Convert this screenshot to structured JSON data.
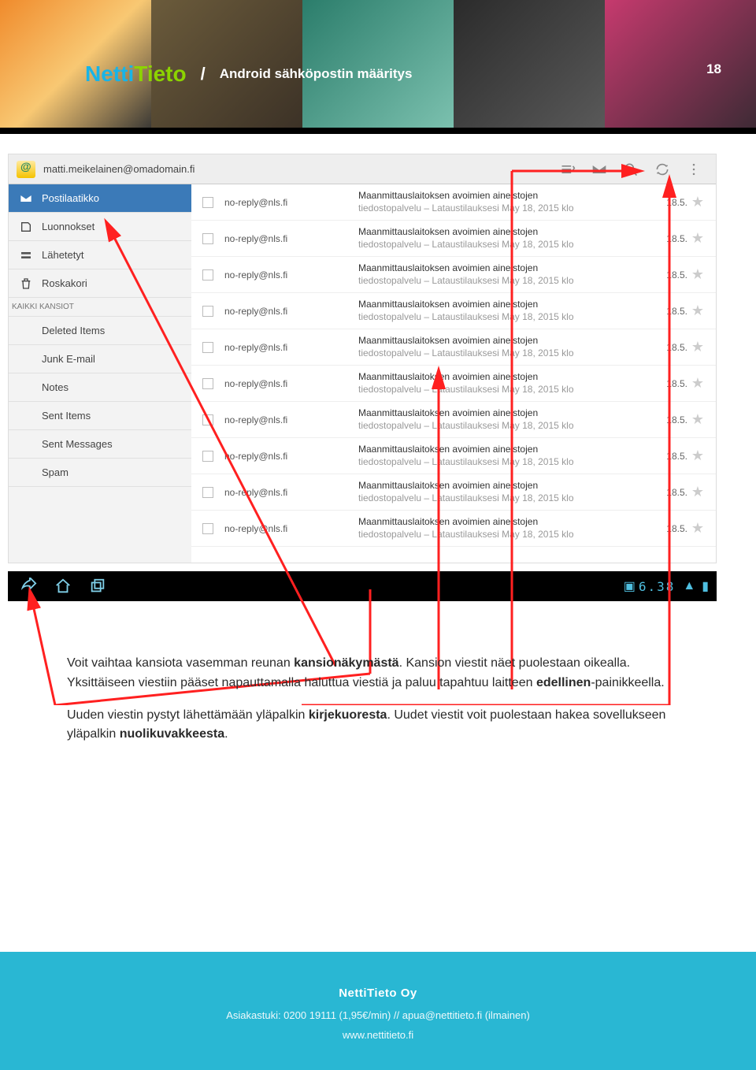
{
  "header": {
    "logo_parts": {
      "a": "Netti",
      "b": "Tieto"
    },
    "separator": "/",
    "title": "Android sähköpostin määritys",
    "page_number": "18"
  },
  "app": {
    "account": "matti.meikelainen@omadomain.fi"
  },
  "folders": {
    "main": [
      {
        "label": "Postilaatikko",
        "active": true,
        "icon": "inbox"
      },
      {
        "label": "Luonnokset",
        "icon": "draft"
      },
      {
        "label": "Lähetetyt",
        "icon": "sent"
      },
      {
        "label": "Roskakori",
        "icon": "trash"
      }
    ],
    "section": "KAIKKI KANSIOT",
    "all": [
      {
        "label": "Deleted Items"
      },
      {
        "label": "Junk E-mail"
      },
      {
        "label": "Notes"
      },
      {
        "label": "Sent Items"
      },
      {
        "label": "Sent Messages"
      },
      {
        "label": "Spam"
      }
    ]
  },
  "mail_row": {
    "from": "no-reply@nls.fi",
    "subject_line1": "Maanmittauslaitoksen avoimien aineistojen",
    "subject_line2": "tiedostopalvelu – Lataustilauksesi May 18, 2015 klo",
    "date": "18.5."
  },
  "mail_count": 10,
  "navbar": {
    "clock": "6.38"
  },
  "instructions": {
    "p1_a": "Voit vaihtaa kansiota vasemman reunan ",
    "p1_b": "kansionäkymästä",
    "p1_c": ". Kansion viestit näet puolestaan oikealla. Yksittäiseen viestiin pääset napauttamalla haluttua viestiä ja paluu tapahtuu laitteen ",
    "p1_d": "edellinen",
    "p1_e": "-painikkeella.",
    "p2_a": "Uuden viestin pystyt lähettämään yläpalkin ",
    "p2_b": "kirjekuoresta",
    "p2_c": ". Uudet viestit  voit puolestaan hakea sovellukseen yläpalkin ",
    "p2_d": "nuolikuvakkeesta",
    "p2_e": "."
  },
  "footer": {
    "company": "NettiTieto Oy",
    "support": "Asiakastuki: 0200 19111 (1,95€/min)   //   apua@nettitieto.fi (ilmainen)",
    "url": "www.nettitieto.fi"
  }
}
